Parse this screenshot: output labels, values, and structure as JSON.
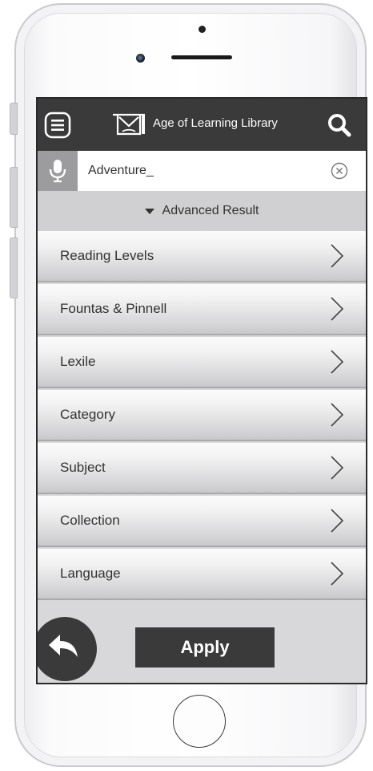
{
  "app": {
    "title": "Age of Learning Library"
  },
  "search": {
    "value": "Adventure_"
  },
  "advanced": {
    "label": "Advanced Result"
  },
  "filters": [
    {
      "label": "Reading Levels"
    },
    {
      "label": "Fountas & Pinnell"
    },
    {
      "label": "Lexile"
    },
    {
      "label": "Category"
    },
    {
      "label": "Subject"
    },
    {
      "label": "Collection"
    },
    {
      "label": "Language"
    }
  ],
  "actions": {
    "apply_label": "Apply"
  },
  "icons": {
    "menu": "menu-icon",
    "logo": "book-logo-icon",
    "search": "search-icon",
    "mic": "microphone-icon",
    "clear": "clear-icon",
    "chevron": "chevron-right-icon",
    "back": "back-arrow-icon"
  },
  "colors": {
    "app_bar": "#3a3a3a",
    "screen_bg": "#d8d8da",
    "mic_box": "#9c9c9e",
    "text": "#333333",
    "button": "#3a3a3a"
  }
}
